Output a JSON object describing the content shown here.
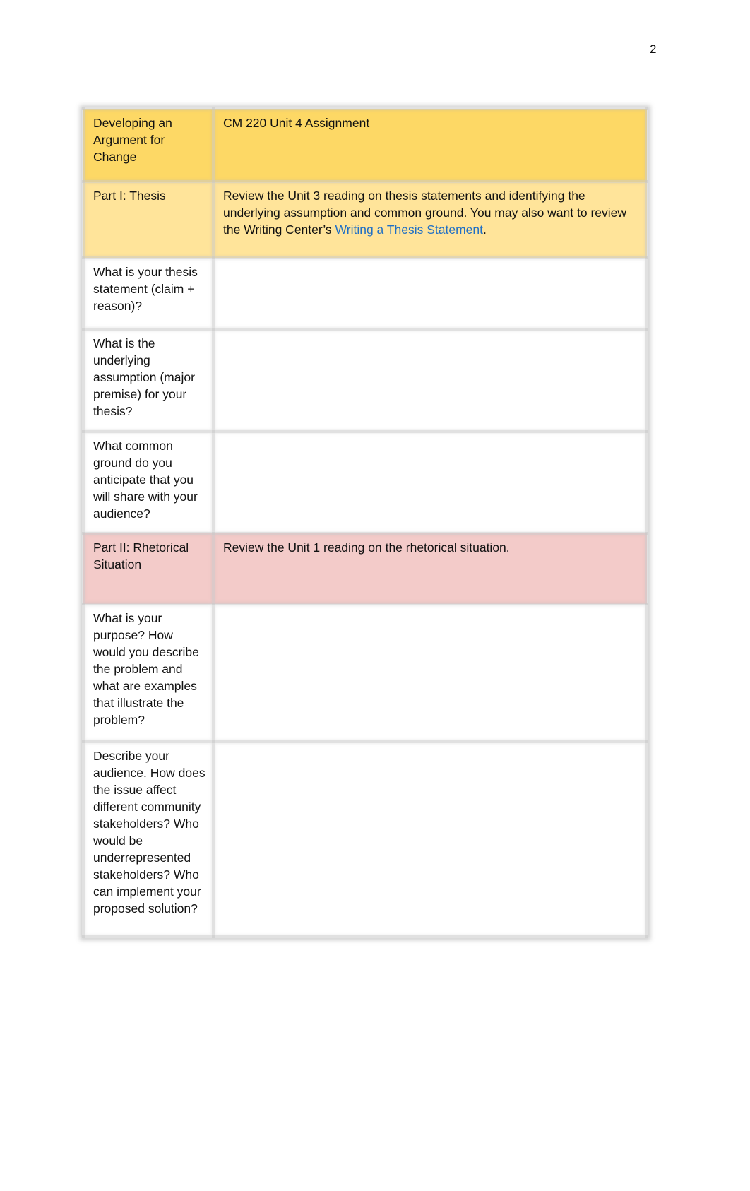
{
  "page": {
    "number": "2"
  },
  "table": {
    "header": {
      "label": "Developing an Argument for Change",
      "value": "CM 220 Unit 4 Assignment"
    },
    "part1": {
      "label": "Part I: Thesis",
      "instruction_prefix": "Review the Unit 3 reading on thesis statements and identifying the underlying assumption and common ground. You may also want to review the Writing Center’s ",
      "link_text": "Writing a Thesis Statement",
      "instruction_suffix": "."
    },
    "part1_questions": [
      {
        "question": "What is your thesis statement (claim + reason)?",
        "answer": ""
      },
      {
        "question": "What is the underlying assumption (major premise) for your thesis?",
        "answer": ""
      },
      {
        "question": "What common ground do you anticipate that you will share with your audience?",
        "answer": ""
      }
    ],
    "part2": {
      "label": "Part II: Rhetorical Situation",
      "instruction": "Review the Unit 1 reading on the rhetorical situation."
    },
    "part2_questions": [
      {
        "question": "What is your purpose? How would you describe the problem and what are examples that illustrate the problem?",
        "answer": ""
      },
      {
        "question": "Describe your audience. How does the issue affect different community stakeholders? Who would be underrepresented stakeholders? Who can implement your proposed solution?",
        "answer": ""
      }
    ]
  },
  "colors": {
    "header_bg": "#fdd865",
    "part1_bg": "#ffe49a",
    "part2_bg": "#f3cbc9",
    "link": "#1f6fc5"
  }
}
